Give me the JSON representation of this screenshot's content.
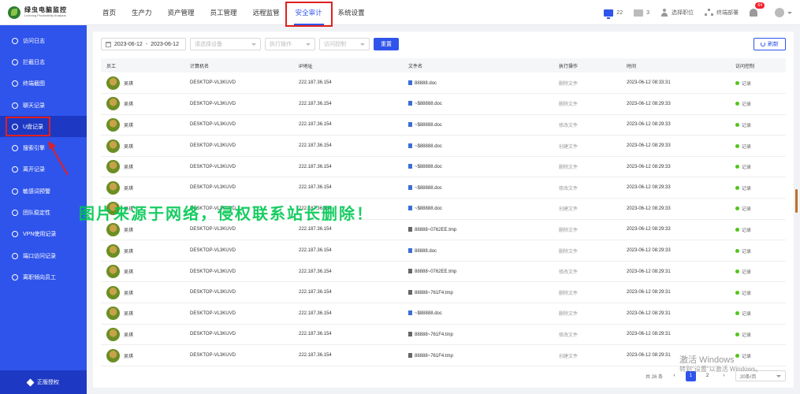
{
  "brand": {
    "title": "绿虫电脑监控",
    "subtitle": "Lvchong Productivity Analysis"
  },
  "nav": {
    "items": [
      "首页",
      "生产力",
      "资产管理",
      "员工管理",
      "远程监管",
      "安全审计",
      "系统设置"
    ],
    "active": "安全审计"
  },
  "header_right": {
    "online_count": "22",
    "offline_count": "3",
    "select_position": "选择职位",
    "terminal_deploy": "终端部署",
    "notification_badge": "64"
  },
  "sidebar": {
    "items": [
      "访问日志",
      "拦截日志",
      "终端截图",
      "聊天记录",
      "U盘记录",
      "搜索引擎",
      "离开记录",
      "敏感词预警",
      "团队稳定性",
      "VPN使用记录",
      "端口访问记录",
      "离职倾向员工"
    ],
    "active": "U盘记录",
    "footer": "正版授权"
  },
  "filters": {
    "date_start": "2023-06-12",
    "date_sep": "-",
    "date_end": "2023-06-12",
    "device_placeholder": "请选择设备",
    "op_placeholder": "执行操作",
    "access_placeholder": "访问控制",
    "reset_label": "重置",
    "refresh_label": "刷新"
  },
  "table": {
    "columns": [
      "员工",
      "计算机名",
      "IP地址",
      "文件名",
      "执行操作",
      "时间",
      "访问控制"
    ],
    "rows": [
      {
        "emp": "吴琪",
        "pc": "DESKTOP-VL3KUVD",
        "ip": "222.187.36.154",
        "file": "88888.doc",
        "ftype": "doc",
        "op": "删除文件",
        "time": "2023-06-12 08:33:31",
        "ctl": "记录"
      },
      {
        "emp": "吴琪",
        "pc": "DESKTOP-VL3KUVD",
        "ip": "222.187.36.154",
        "file": "~$88888.doc",
        "ftype": "doc",
        "op": "删除文件",
        "time": "2023-06-12 08:29:33",
        "ctl": "记录"
      },
      {
        "emp": "吴琪",
        "pc": "DESKTOP-VL3KUVD",
        "ip": "222.187.36.154",
        "file": "~$88888.doc",
        "ftype": "doc",
        "op": "修改文件",
        "time": "2023-06-12 08:29:33",
        "ctl": "记录"
      },
      {
        "emp": "吴琪",
        "pc": "DESKTOP-VL3KUVD",
        "ip": "222.187.36.154",
        "file": "~$88888.doc",
        "ftype": "doc",
        "op": "创建文件",
        "time": "2023-06-12 08:29:33",
        "ctl": "记录"
      },
      {
        "emp": "吴琪",
        "pc": "DESKTOP-VL3KUVD",
        "ip": "222.187.36.154",
        "file": "~$88888.doc",
        "ftype": "doc",
        "op": "删除文件",
        "time": "2023-06-12 08:29:33",
        "ctl": "记录"
      },
      {
        "emp": "吴琪",
        "pc": "DESKTOP-VL3KUVD",
        "ip": "222.187.36.154",
        "file": "~$88888.doc",
        "ftype": "doc",
        "op": "修改文件",
        "time": "2023-06-12 08:29:33",
        "ctl": "记录"
      },
      {
        "emp": "吴琪",
        "pc": "DESKTOP-VL3KUVD",
        "ip": "222.187.36.154",
        "file": "~$88888.doc",
        "ftype": "doc",
        "op": "创建文件",
        "time": "2023-06-12 08:29:33",
        "ctl": "记录"
      },
      {
        "emp": "吴琪",
        "pc": "DESKTOP-VL3KUVD",
        "ip": "222.187.36.154",
        "file": "88888~0762EE.tmp",
        "ftype": "tmp",
        "op": "删除文件",
        "time": "2023-06-12 08:29:33",
        "ctl": "记录"
      },
      {
        "emp": "吴琪",
        "pc": "DESKTOP-VL3KUVD",
        "ip": "222.187.36.154",
        "file": "88888.doc",
        "ftype": "doc",
        "op": "删除文件",
        "time": "2023-06-12 08:29:33",
        "ctl": "记录"
      },
      {
        "emp": "吴琪",
        "pc": "DESKTOP-VL3KUVD",
        "ip": "222.187.36.154",
        "file": "88888~0762EE.tmp",
        "ftype": "tmp",
        "op": "修改文件",
        "time": "2023-06-12 08:29:31",
        "ctl": "记录"
      },
      {
        "emp": "吴琪",
        "pc": "DESKTOP-VL3KUVD",
        "ip": "222.187.36.154",
        "file": "88888~761F4.tmp",
        "ftype": "tmp",
        "op": "删除文件",
        "time": "2023-06-12 08:29:31",
        "ctl": "记录"
      },
      {
        "emp": "吴琪",
        "pc": "DESKTOP-VL3KUVD",
        "ip": "222.187.36.154",
        "file": "~$88888.doc",
        "ftype": "doc",
        "op": "删除文件",
        "time": "2023-06-12 08:29:31",
        "ctl": "记录"
      },
      {
        "emp": "吴琪",
        "pc": "DESKTOP-VL3KUVD",
        "ip": "222.187.36.154",
        "file": "88888~761F4.tmp",
        "ftype": "tmp",
        "op": "修改文件",
        "time": "2023-06-12 08:29:31",
        "ctl": "记录"
      },
      {
        "emp": "吴琪",
        "pc": "DESKTOP-VL3KUVD",
        "ip": "222.187.36.154",
        "file": "88888~761F4.tmp",
        "ftype": "tmp",
        "op": "创建文件",
        "time": "2023-06-12 08:29:31",
        "ctl": "记录"
      }
    ]
  },
  "pager": {
    "total": "共 26 条",
    "pages": [
      "1",
      "2"
    ],
    "current": "1",
    "page_size": "20条/页"
  },
  "overlays": {
    "watermark": "图片来源于网络，侵权联系站长删除！",
    "activate_title": "激活 Windows",
    "activate_sub": "转到\"设置\"以激活 Windows。"
  },
  "colors": {
    "accent": "#2f54eb",
    "highlight_box": "#e02020",
    "watermark": "#00c853",
    "status_dot": "#52c41a"
  }
}
